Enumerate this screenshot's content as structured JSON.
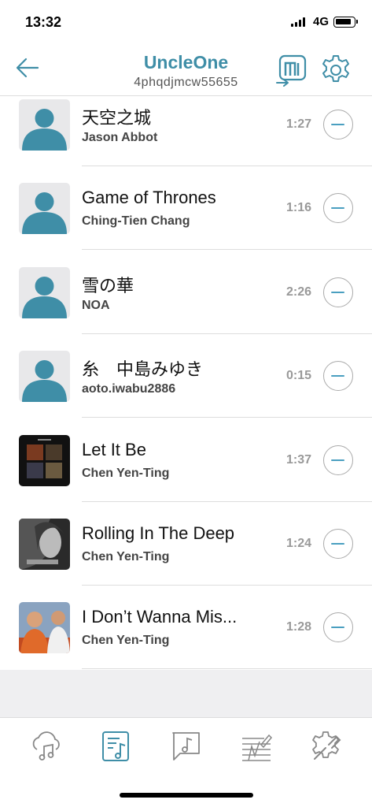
{
  "status_bar": {
    "time": "13:32",
    "network": "4G",
    "signal_bars": 4,
    "battery_level": 0.85
  },
  "header": {
    "title": "UncleOne",
    "subtitle": "4phqdjmcw55655",
    "back_icon": "arrow-left-icon",
    "room_icon": "exit-room-icon",
    "settings_icon": "gear-icon"
  },
  "songs": [
    {
      "title": "天空之城",
      "artist": "Jason Abbot",
      "duration": "1:27",
      "thumb": "avatar-placeholder"
    },
    {
      "title": "Game of Thrones",
      "artist": "Ching-Tien Chang",
      "duration": "1:16",
      "thumb": "avatar-placeholder"
    },
    {
      "title": "雪の華",
      "artist": "NOA",
      "duration": "2:26",
      "thumb": "avatar-placeholder"
    },
    {
      "title": "糸　中島みゆき",
      "artist": "aoto.iwabu2886",
      "duration": "0:15",
      "thumb": "avatar-placeholder"
    },
    {
      "title": "Let It Be",
      "artist": "Chen Yen-Ting",
      "duration": "1:37",
      "thumb": "album-let-it-be"
    },
    {
      "title": "Rolling In The Deep",
      "artist": "Chen Yen-Ting",
      "duration": "1:24",
      "thumb": "album-adele"
    },
    {
      "title": "I Don’t Wanna Mis...",
      "artist": "Chen Yen-Ting",
      "duration": "1:28",
      "thumb": "album-armageddon"
    }
  ],
  "tabs": [
    {
      "name": "cloud-music-icon",
      "active": false
    },
    {
      "name": "playlist-icon",
      "active": true
    },
    {
      "name": "chat-music-icon",
      "active": false
    },
    {
      "name": "equalizer-icon",
      "active": false
    },
    {
      "name": "settings-tools-icon",
      "active": false
    }
  ],
  "colors": {
    "accent": "#3f8ea7",
    "remove_accent": "#4a9fc0",
    "avatar_bg": "#e8e8ea",
    "avatar_fg": "#3f8ea7",
    "filler": "#efeff1"
  }
}
